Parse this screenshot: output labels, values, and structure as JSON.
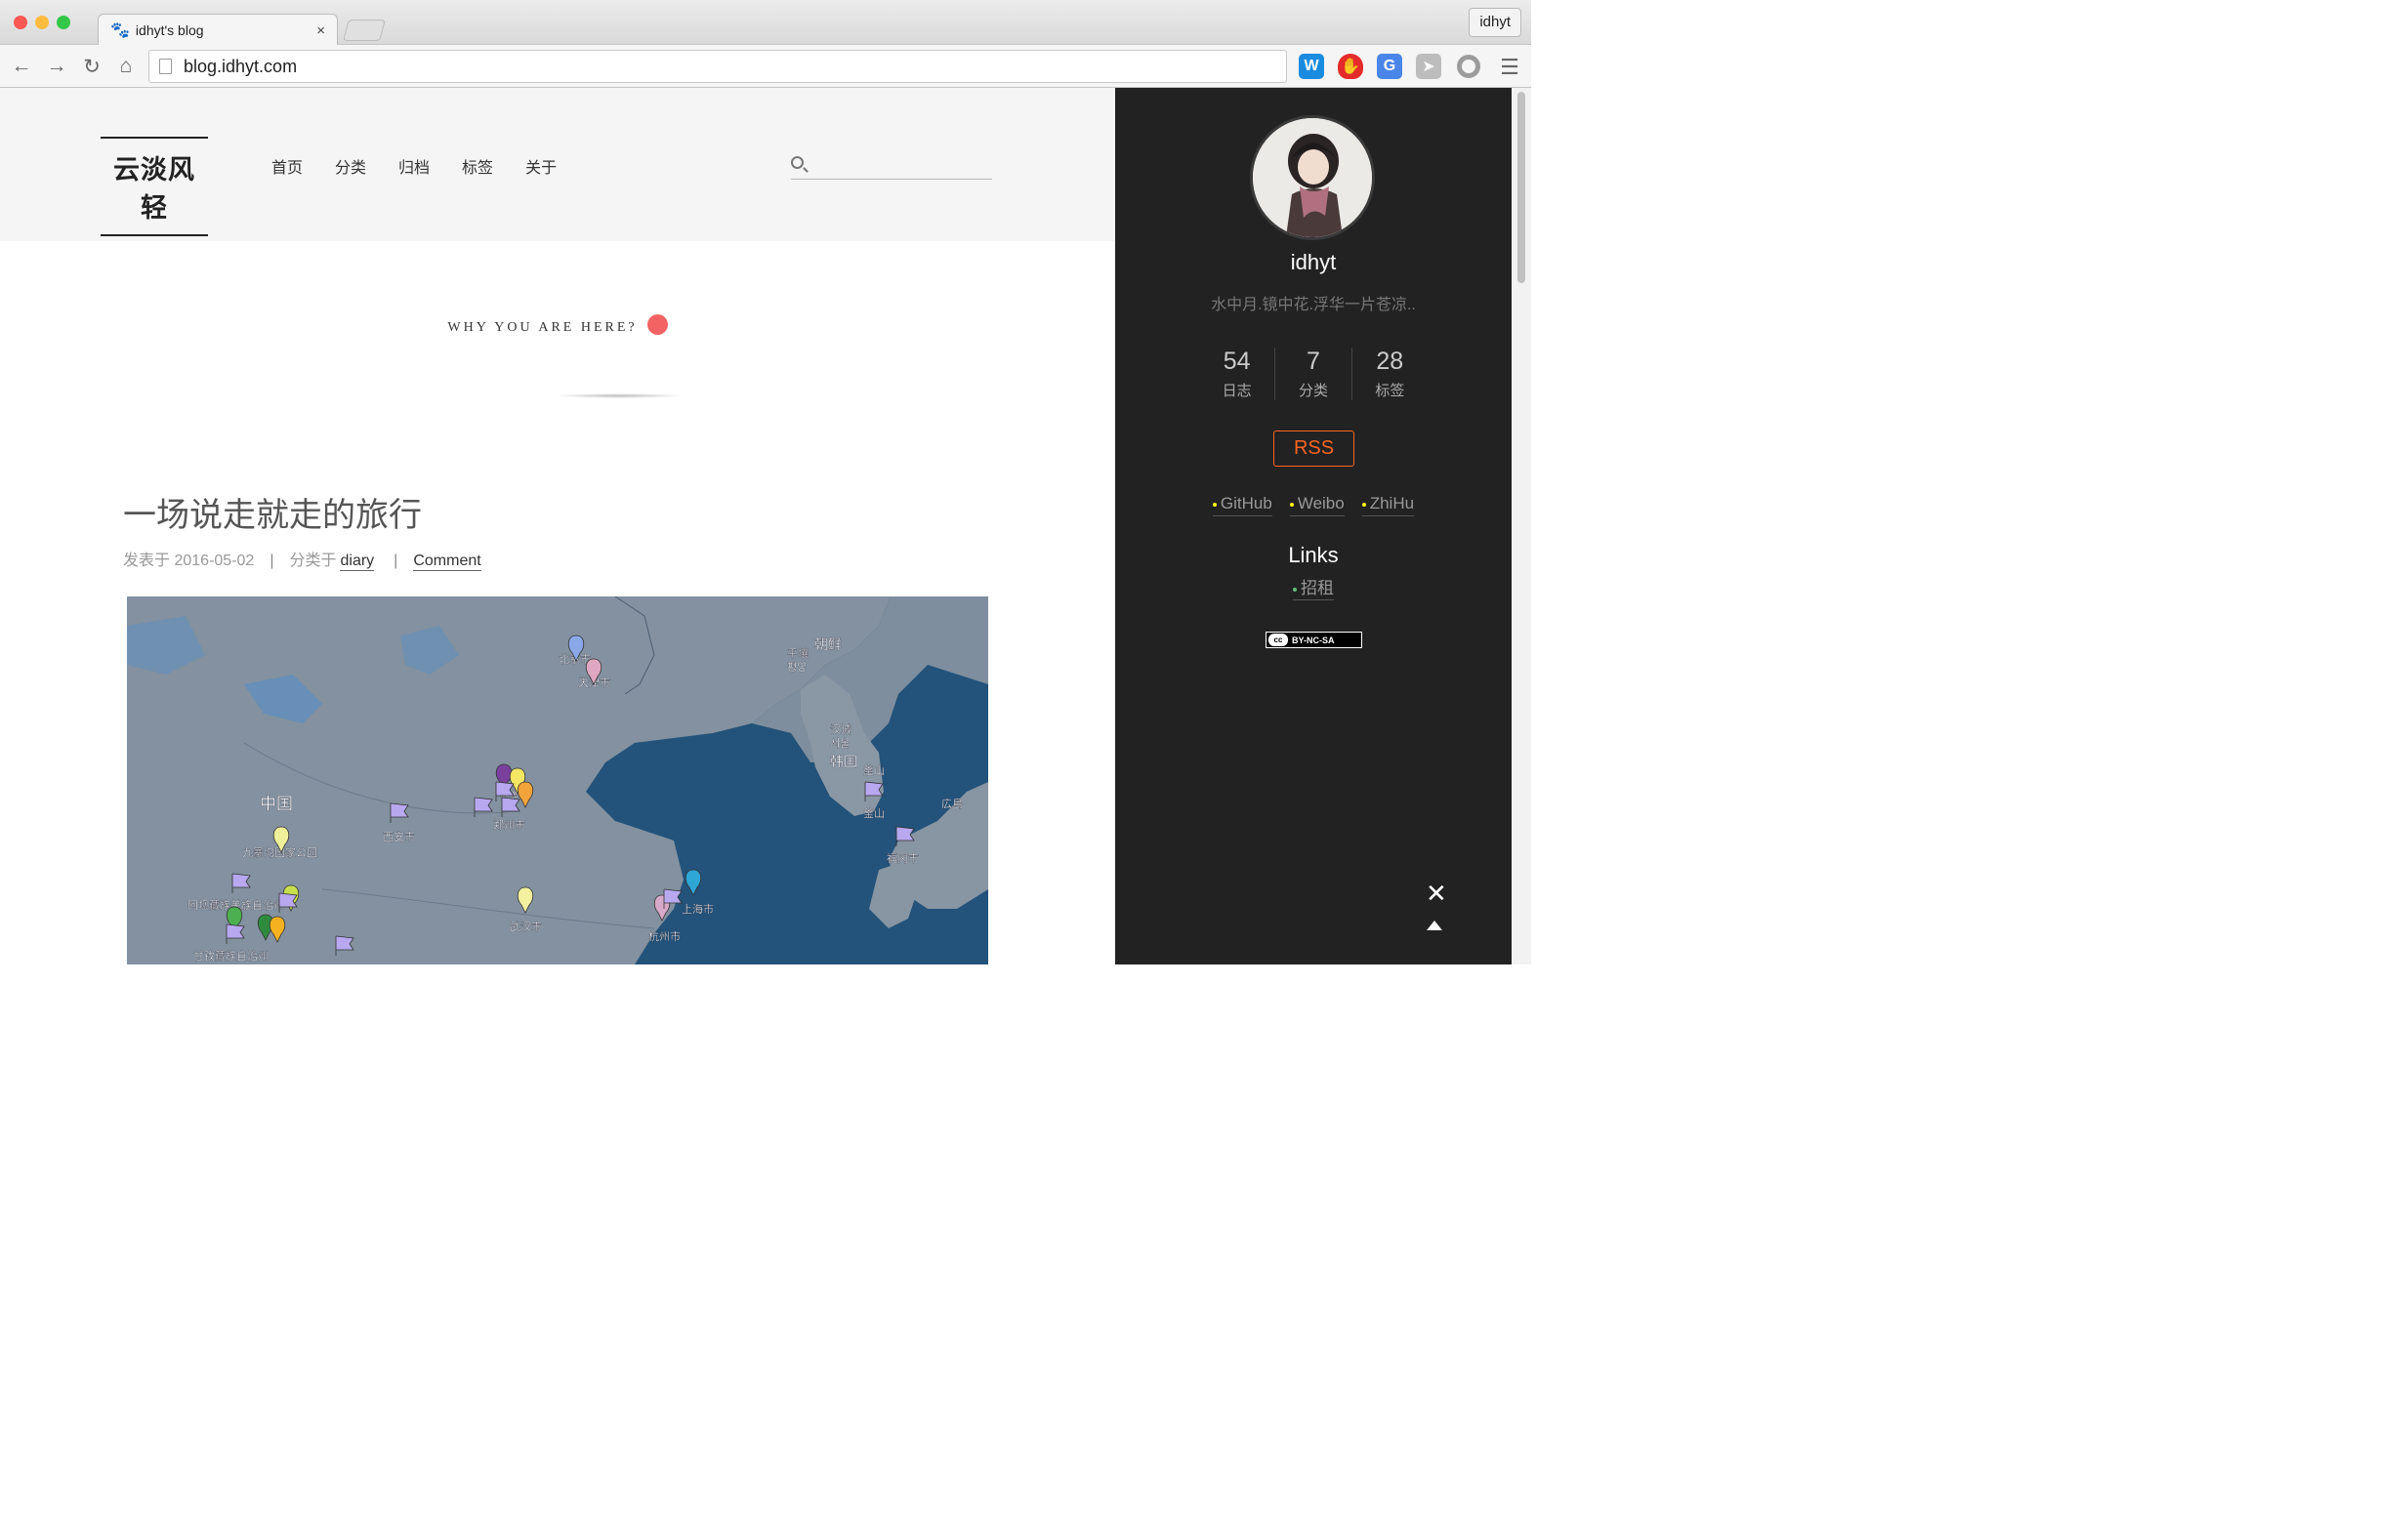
{
  "browser": {
    "tab_title": "idhyt's blog",
    "tab_close": "×",
    "profile_name": "idhyt",
    "url": "blog.idhyt.com",
    "extensions": [
      "word-icon",
      "shield-icon",
      "translate-icon",
      "cursor-icon",
      "circle-icon"
    ],
    "colors": {
      "close": "#fc5753",
      "minimize": "#fdbc40",
      "maximize": "#33c748"
    }
  },
  "site": {
    "logo": "云淡风轻",
    "menu": [
      "首页",
      "分类",
      "归档",
      "标签",
      "关于"
    ],
    "motto": "WHY YOU ARE HERE?",
    "accent": "#f46363"
  },
  "post": {
    "title": "一场说走就走的旅行",
    "posted_label": "发表于",
    "date": "2016-05-02",
    "category_label": "分类于",
    "category": "diary",
    "comment": "Comment",
    "sep": "|"
  },
  "map": {
    "labels": {
      "beijing": "北京市",
      "tianjin": "天津市",
      "xinxiang": "新乡市",
      "zhengzhou": "郑州市",
      "xian": "西安市",
      "china": "中国",
      "jiuzhaigou": "九寨沟国家公园",
      "aba": "阿坝藏族羌族自治州",
      "ganzi": "甘孜藏族自治州",
      "wuhan": "武汉市",
      "shanghai": "上海市",
      "hangzhou": "杭州市",
      "korea": "韩国",
      "hancheng": "汉城",
      "seoul": "서울",
      "pyongyang": "平壤",
      "pyongyang_kr": "평양",
      "north_korea": "朝鲜",
      "busan": "釜山",
      "busan2": "釜山",
      "fukuoka": "福冈市",
      "hiroshima": "広島"
    }
  },
  "sidebar": {
    "name": "idhyt",
    "description": "水中月.镜中花.浮华一片苍凉..",
    "stats": [
      {
        "count": "54",
        "label": "日志"
      },
      {
        "count": "7",
        "label": "分类"
      },
      {
        "count": "28",
        "label": "标签"
      }
    ],
    "rss": "RSS",
    "social": [
      "GitHub",
      "Weibo",
      "ZhiHu"
    ],
    "links_title": "Links",
    "friend_link": "招租",
    "license": "BY-NC-SA",
    "license_icon": "cc"
  }
}
